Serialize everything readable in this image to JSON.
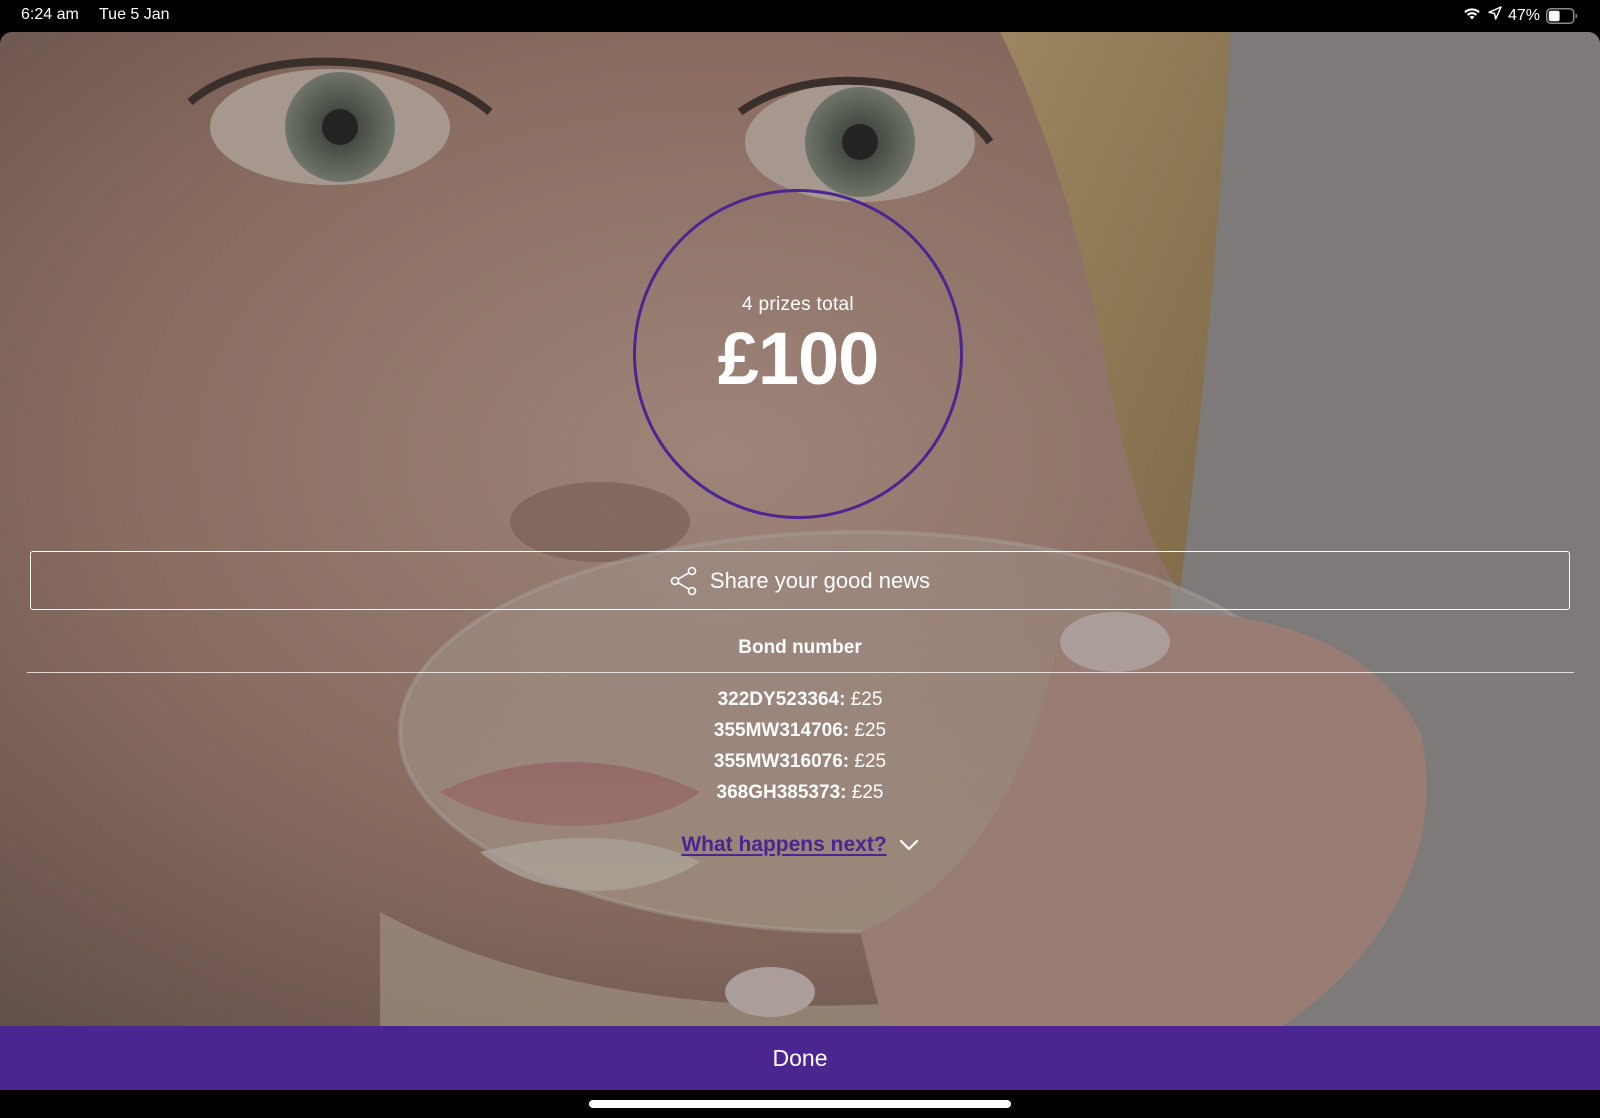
{
  "status_bar": {
    "time": "6:24 am",
    "date": "Tue 5 Jan",
    "battery_percent": "47%",
    "battery_level": 0.47,
    "icons": [
      "wifi-icon",
      "location-icon",
      "battery-icon"
    ]
  },
  "prize": {
    "subtitle": "4 prizes total",
    "amount": "£100"
  },
  "share": {
    "icon": "share-icon",
    "label": "Share your good news"
  },
  "bonds": {
    "header": "Bond number",
    "rows": [
      {
        "number": "322DY523364:",
        "amount": "£25"
      },
      {
        "number": "355MW314706:",
        "amount": "£25"
      },
      {
        "number": "355MW316076:",
        "amount": "£25"
      },
      {
        "number": "368GH385373:",
        "amount": "£25"
      }
    ]
  },
  "next": {
    "label": "What happens next?",
    "icon": "chevron-down-icon"
  },
  "done_label": "Done",
  "colors": {
    "accent": "#4b2590",
    "text": "#ffffff",
    "status_bar_bg": "#000000"
  }
}
